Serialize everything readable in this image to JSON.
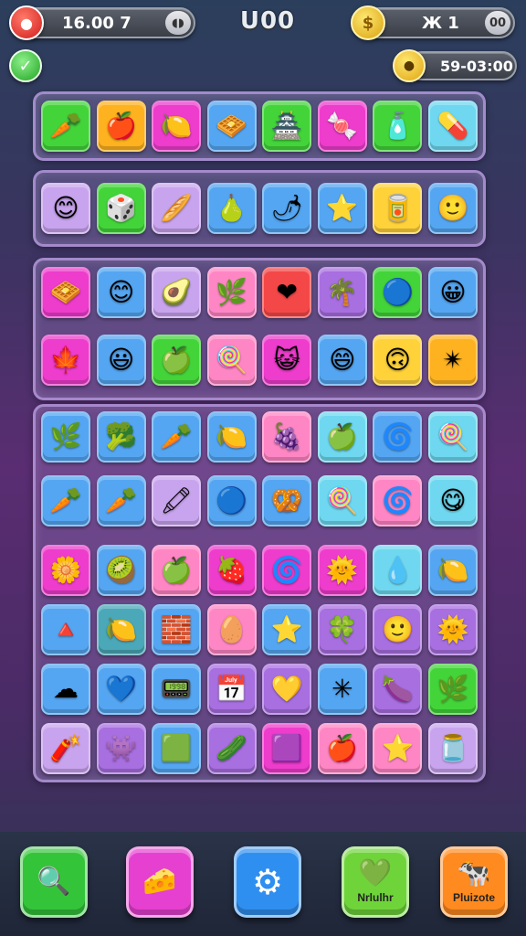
{
  "hud": {
    "lives_value": "16.00 7",
    "lives_icon": "red-heart-icon",
    "lives_cap": "◖◗",
    "score": "U00",
    "coins_value": "Ж 1",
    "coins_icon": "gold-coin-icon",
    "coins_cap": "00",
    "timer_value": "59-03:00",
    "timer_icon": "clock-icon",
    "check_icon": "✓"
  },
  "colors": {
    "green": "#43d43a",
    "orange": "#ffb21f",
    "magenta": "#ee3ccc",
    "blue": "#55a6f2",
    "purple": "#a86fe0",
    "lilac": "#c9a4ee",
    "pink": "#ff86c5",
    "cyan": "#6fd8f0",
    "yellow": "#ffd23a",
    "red": "#f44848",
    "teal": "#4aa8b8"
  },
  "board": {
    "row1": [
      {
        "bg": "green",
        "icon": "🥕",
        "name": "carrot"
      },
      {
        "bg": "orange",
        "icon": "🍎",
        "name": "apple"
      },
      {
        "bg": "magenta",
        "icon": "🍋",
        "name": "lemon"
      },
      {
        "bg": "blue",
        "icon": "🧇",
        "name": "waffle"
      },
      {
        "bg": "green",
        "icon": "🏯",
        "name": "tower"
      },
      {
        "bg": "magenta",
        "icon": "🍬",
        "name": "candy"
      },
      {
        "bg": "green",
        "icon": "🧴",
        "name": "bottle"
      },
      {
        "bg": "cyan",
        "icon": "💊",
        "name": "capsule"
      }
    ],
    "row2": [
      {
        "bg": "lilac",
        "icon": "😊",
        "name": "sun-face"
      },
      {
        "bg": "green",
        "icon": "🎲",
        "name": "dice"
      },
      {
        "bg": "lilac",
        "icon": "🥖",
        "name": "bread"
      },
      {
        "bg": "blue",
        "icon": "🍐",
        "name": "pear"
      },
      {
        "bg": "blue",
        "icon": "🌶",
        "name": "pepper"
      },
      {
        "bg": "blue",
        "icon": "⭐",
        "name": "star"
      },
      {
        "bg": "yellow",
        "icon": "🥫",
        "name": "can"
      },
      {
        "bg": "blue",
        "icon": "🙂",
        "name": "smiley"
      }
    ],
    "row3": [
      {
        "bg": "magenta",
        "icon": "🧇",
        "name": "waffle"
      },
      {
        "bg": "blue",
        "icon": "😊",
        "name": "smiley"
      },
      {
        "bg": "lilac",
        "icon": "🥑",
        "name": "avocado"
      },
      {
        "bg": "pink",
        "icon": "🌿",
        "name": "leaf"
      },
      {
        "bg": "red",
        "icon": "❤",
        "name": "heart"
      },
      {
        "bg": "purple",
        "icon": "🌴",
        "name": "palm"
      },
      {
        "bg": "green",
        "icon": "🔵",
        "name": "berry"
      },
      {
        "bg": "blue",
        "icon": "😀",
        "name": "face"
      }
    ],
    "row4": [
      {
        "bg": "magenta",
        "icon": "🍁",
        "name": "maple"
      },
      {
        "bg": "blue",
        "icon": "😃",
        "name": "blue-face"
      },
      {
        "bg": "green",
        "icon": "🍏",
        "name": "green-apple"
      },
      {
        "bg": "pink",
        "icon": "🍭",
        "name": "lollipop"
      },
      {
        "bg": "magenta",
        "icon": "😺",
        "name": "cat-face"
      },
      {
        "bg": "blue",
        "icon": "😄",
        "name": "lime-face"
      },
      {
        "bg": "yellow",
        "icon": "🙃",
        "name": "orange-face"
      },
      {
        "bg": "orange",
        "icon": "✴",
        "name": "starburst"
      }
    ],
    "row5": [
      {
        "bg": "blue",
        "icon": "🌿",
        "name": "herb"
      },
      {
        "bg": "blue",
        "icon": "🥦",
        "name": "broccoli"
      },
      {
        "bg": "blue",
        "icon": "🥕",
        "name": "carrot"
      },
      {
        "bg": "blue",
        "icon": "🍋",
        "name": "lemon"
      },
      {
        "bg": "pink",
        "icon": "🍇",
        "name": "grape"
      },
      {
        "bg": "cyan",
        "icon": "🍏",
        "name": "apple"
      },
      {
        "bg": "blue",
        "icon": "🌀",
        "name": "swirl"
      },
      {
        "bg": "cyan",
        "icon": "🍭",
        "name": "lollipop"
      }
    ],
    "row6": [
      {
        "bg": "blue",
        "icon": "🥕",
        "name": "carrot"
      },
      {
        "bg": "blue",
        "icon": "🥕",
        "name": "carrot-2"
      },
      {
        "bg": "lilac",
        "icon": "🖍",
        "name": "crayon"
      },
      {
        "bg": "blue",
        "icon": "🔵",
        "name": "blue-berry"
      },
      {
        "bg": "blue",
        "icon": "🥨",
        "name": "pretzel"
      },
      {
        "bg": "cyan",
        "icon": "🍭",
        "name": "candy-pink"
      },
      {
        "bg": "pink",
        "icon": "🌀",
        "name": "purple-swirl"
      },
      {
        "bg": "cyan",
        "icon": "😋",
        "name": "green-face"
      }
    ],
    "row7": [
      {
        "bg": "magenta",
        "icon": "🌼",
        "name": "flower"
      },
      {
        "bg": "blue",
        "icon": "🥝",
        "name": "kiwi"
      },
      {
        "bg": "pink",
        "icon": "🍏",
        "name": "green-apple"
      },
      {
        "bg": "magenta",
        "icon": "🍓",
        "name": "strawberry"
      },
      {
        "bg": "magenta",
        "icon": "🌀",
        "name": "orange-swirl"
      },
      {
        "bg": "magenta",
        "icon": "🌞",
        "name": "sun"
      },
      {
        "bg": "cyan",
        "icon": "💧",
        "name": "drop"
      },
      {
        "bg": "blue",
        "icon": "🍋",
        "name": "lemon"
      }
    ],
    "row8": [
      {
        "bg": "blue",
        "icon": "🔺",
        "name": "triangle"
      },
      {
        "bg": "teal",
        "icon": "🍋",
        "name": "lemon"
      },
      {
        "bg": "blue",
        "icon": "🧱",
        "name": "brick"
      },
      {
        "bg": "pink",
        "icon": "🥚",
        "name": "egg"
      },
      {
        "bg": "blue",
        "icon": "⭐",
        "name": "star"
      },
      {
        "bg": "purple",
        "icon": "🍀",
        "name": "clover"
      },
      {
        "bg": "purple",
        "icon": "🙂",
        "name": "smiley"
      },
      {
        "bg": "purple",
        "icon": "🌞",
        "name": "sun"
      }
    ],
    "row9": [
      {
        "bg": "blue",
        "icon": "☁",
        "name": "cloud"
      },
      {
        "bg": "blue",
        "icon": "💙",
        "name": "heart"
      },
      {
        "bg": "blue",
        "icon": "📟",
        "name": "gadget"
      },
      {
        "bg": "purple",
        "icon": "📅",
        "name": "calendar"
      },
      {
        "bg": "purple",
        "icon": "💛",
        "name": "yellow-heart"
      },
      {
        "bg": "blue",
        "icon": "✳",
        "name": "snowflake"
      },
      {
        "bg": "purple",
        "icon": "🍆",
        "name": "plum"
      },
      {
        "bg": "green",
        "icon": "🌿",
        "name": "leaf"
      }
    ],
    "row10": [
      {
        "bg": "lilac",
        "icon": "🧨",
        "name": "rocket"
      },
      {
        "bg": "purple",
        "icon": "👾",
        "name": "monster"
      },
      {
        "bg": "blue",
        "icon": "🟩",
        "name": "green-block"
      },
      {
        "bg": "purple",
        "icon": "🥒",
        "name": "cucumber"
      },
      {
        "bg": "magenta",
        "icon": "🟪",
        "name": "box"
      },
      {
        "bg": "pink",
        "icon": "🍎",
        "name": "apple"
      },
      {
        "bg": "pink",
        "icon": "⭐",
        "name": "star"
      },
      {
        "bg": "lilac",
        "icon": "🫙",
        "name": "jar"
      }
    ]
  },
  "bottom": {
    "b1": {
      "icon": "🔍",
      "label": "",
      "bg": "#34c43a"
    },
    "b2": {
      "icon": "🧀",
      "label": "",
      "bg": "#e640d0"
    },
    "b3": {
      "icon": "⚙",
      "label": "",
      "bg": "#2f8ff0"
    },
    "b4": {
      "icon": "💚",
      "label": "Nrlulhr",
      "bg": "#6fd43a"
    },
    "b5": {
      "icon": "🐄",
      "label": "Pluizote",
      "bg": "#ff8a1f"
    }
  }
}
